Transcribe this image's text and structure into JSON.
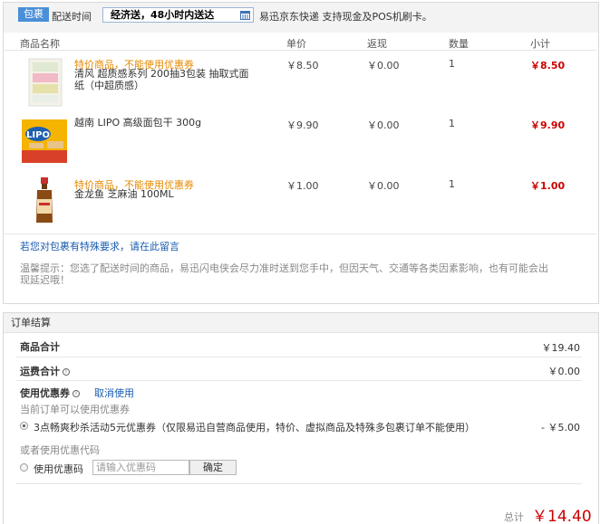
{
  "package": {
    "badge": "包裹",
    "ship_time_label": "配送时间",
    "ship_time_value": "经济送，48小时内送达",
    "ship_desc": "易迅京东快递 支持现金及POS机刷卡。",
    "columns": [
      "商品名称",
      "单价",
      "返现",
      "数量",
      "小计"
    ],
    "items": [
      {
        "promo": "特价商品，不能使用优惠券",
        "name_line1": "清风 超质感系列 200抽3包装 抽取式面",
        "name_line2": "纸（中超质感）",
        "price": "￥8.50",
        "cashback": "￥0.00",
        "qty": "1",
        "subtotal": "￥8.50"
      },
      {
        "promo": "",
        "name_line1": "越南 LIPO 高级面包干 300g",
        "name_line2": "",
        "price": "￥9.90",
        "cashback": "￥0.00",
        "qty": "1",
        "subtotal": "￥9.90"
      },
      {
        "promo": "特价商品，不能使用优惠券",
        "name_line1": "金龙鱼 芝麻油 100ML",
        "name_line2": "",
        "price": "￥1.00",
        "cashback": "￥0.00",
        "qty": "1",
        "subtotal": "￥1.00"
      }
    ],
    "special_request_link": "若您对包裹有特殊要求，请在此留言",
    "notice_line1": "温馨提示：您选了配送时间的商品，易迅闪电侠会尽力准时送到您手中，但因天气、交通等各类因素影响，也有可能会出",
    "notice_line2": "现延迟哦！"
  },
  "settlement": {
    "title": "订单结算",
    "goods_total_label": "商品合计",
    "goods_total_value": "￥19.40",
    "shipping_label": "运费合计",
    "shipping_value": "￥0.00",
    "coupon_label": "使用优惠券",
    "coupon_cancel": "取消使用",
    "coupon_hint": "当前订单可以使用优惠券",
    "coupon_option": "3点畅爽秒杀活动5元优惠券（仅限易迅自营商品使用，特价、虚拟商品及特殊多包裹订单不能使用）",
    "coupon_option_value": "- ￥5.00",
    "code_hint": "或者使用优惠代码",
    "code_label": "使用优惠码",
    "code_placeholder": "请输入优惠码",
    "confirm_button": "确定",
    "total_label": "总计",
    "total_value": "￥14.40"
  },
  "colors": {
    "accent_red": "#cc0000",
    "promo_orange": "#e68a00",
    "link_blue": "#1a5cb0",
    "badge_blue": "#4a8fd8"
  }
}
